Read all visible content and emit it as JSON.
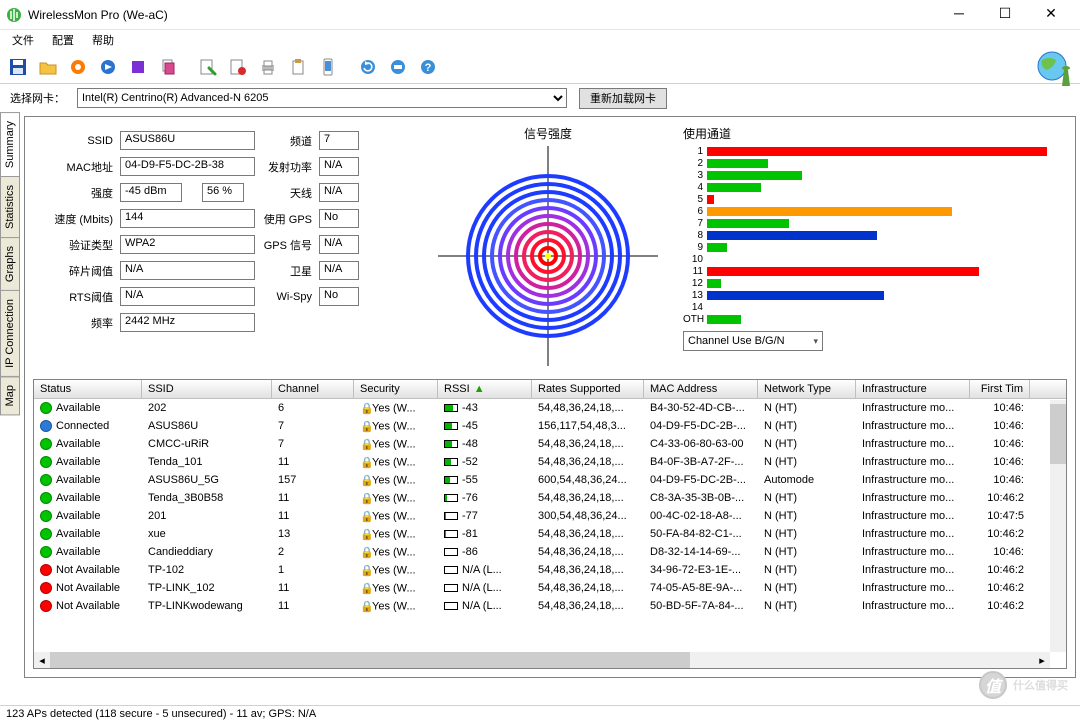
{
  "window": {
    "title": "WirelessMon Pro (We-aC)"
  },
  "menu": {
    "file": "文件",
    "config": "配置",
    "help": "帮助"
  },
  "select_nic": {
    "label": "选择网卡：",
    "value": "Intel(R) Centrino(R) Advanced-N 6205",
    "reload": "重新加载网卡"
  },
  "tabs": {
    "summary": "Summary",
    "statistics": "Statistics",
    "graphs": "Graphs",
    "ipconn": "IP Connection",
    "map": "Map"
  },
  "kv": {
    "ssid_l": "SSID",
    "ssid": "ASUS86U",
    "mac_l": "MAC地址",
    "mac": "04-D9-F5-DC-2B-38",
    "strength_l": "强度",
    "dbm": "-45 dBm",
    "pct": "56 %",
    "speed_l": "速度 (Mbits)",
    "speed": "144",
    "auth_l": "验证类型",
    "auth": "WPA2",
    "frag_l": "碎片阈值",
    "frag": "N/A",
    "rts_l": "RTS阈值",
    "rts": "N/A",
    "freq_l": "频率",
    "freq": "2442 MHz",
    "chan_l": "频道",
    "chan": "7",
    "txp_l": "发射功率",
    "txp": "N/A",
    "ant_l": "天线",
    "ant": "N/A",
    "gps_l": "使用 GPS",
    "gps": "No",
    "gpssig_l": "GPS 信号",
    "gpssig": "N/A",
    "sat_l": "卫星",
    "sat": "N/A",
    "wispy_l": "Wi-Spy",
    "wispy": "No"
  },
  "gauge": {
    "label": "信号强度"
  },
  "channels": {
    "label": "使用通道",
    "dropdown": "Channel Use B/G/N"
  },
  "chart_data": {
    "type": "bar",
    "title": "使用通道",
    "categories": [
      "1",
      "2",
      "3",
      "4",
      "5",
      "6",
      "7",
      "8",
      "9",
      "10",
      "11",
      "12",
      "13",
      "14",
      "OTH"
    ],
    "values": [
      100,
      18,
      28,
      16,
      2,
      72,
      24,
      50,
      6,
      0,
      80,
      4,
      52,
      0,
      10
    ],
    "colors": [
      "#ff0000",
      "#00c400",
      "#00c400",
      "#00c400",
      "#ff0000",
      "#ff9900",
      "#00c400",
      "#0033cc",
      "#00c400",
      "",
      "#ff0000",
      "#00c400",
      "#0033cc",
      "",
      "#00c400"
    ]
  },
  "gridh": {
    "status": "Status",
    "ssid": "SSID",
    "chan": "Channel",
    "sec": "Security",
    "rssi": "RSSI",
    "rates": "Rates Supported",
    "mac": "MAC Address",
    "ntype": "Network Type",
    "infra": "Infrastructure",
    "time": "First Tim"
  },
  "rows": [
    {
      "s": "Available",
      "c": "#00c400",
      "ssid": "202",
      "ch": "6",
      "sec": "Yes (W...",
      "r": "-43",
      "rb": 70,
      "rt": "54,48,36,24,18,...",
      "mac": "B4-30-52-4D-CB-...",
      "nt": "N (HT)",
      "in": "Infrastructure mo...",
      "t": "10:46:"
    },
    {
      "s": "Connected",
      "c": "#2b7ad9",
      "ssid": "ASUS86U",
      "ch": "7",
      "sec": "Yes (W...",
      "r": "-45",
      "rb": 62,
      "rt": "156,117,54,48,3...",
      "mac": "04-D9-F5-DC-2B-...",
      "nt": "N (HT)",
      "in": "Infrastructure mo...",
      "t": "10:46:"
    },
    {
      "s": "Available",
      "c": "#00c400",
      "ssid": "CMCC-uRiR",
      "ch": "7",
      "sec": "Yes (W...",
      "r": "-48",
      "rb": 55,
      "rt": "54,48,36,24,18,...",
      "mac": "C4-33-06-80-63-00",
      "nt": "N (HT)",
      "in": "Infrastructure mo...",
      "t": "10:46:"
    },
    {
      "s": "Available",
      "c": "#00c400",
      "ssid": "Tenda_101",
      "ch": "11",
      "sec": "Yes (W...",
      "r": "-52",
      "rb": 48,
      "rt": "54,48,36,24,18,...",
      "mac": "B4-0F-3B-A7-2F-...",
      "nt": "N (HT)",
      "in": "Infrastructure mo...",
      "t": "10:46:"
    },
    {
      "s": "Available",
      "c": "#00c400",
      "ssid": "ASUS86U_5G",
      "ch": "157",
      "sec": "Yes (W...",
      "r": "-55",
      "rb": 42,
      "rt": "600,54,48,36,24...",
      "mac": "04-D9-F5-DC-2B-...",
      "nt": "Automode",
      "in": "Infrastructure mo...",
      "t": "10:46:"
    },
    {
      "s": "Available",
      "c": "#00c400",
      "ssid": "Tenda_3B0B58",
      "ch": "11",
      "sec": "Yes (W...",
      "r": "-76",
      "rb": 14,
      "rt": "54,48,36,24,18,...",
      "mac": "C8-3A-35-3B-0B-...",
      "nt": "N (HT)",
      "in": "Infrastructure mo...",
      "t": "10:46:2"
    },
    {
      "s": "Available",
      "c": "#00c400",
      "ssid": "201",
      "ch": "11",
      "sec": "Yes (W...",
      "r": "-77",
      "rb": 12,
      "rt": "300,54,48,36,24...",
      "mac": "00-4C-02-18-A8-...",
      "nt": "N (HT)",
      "in": "Infrastructure mo...",
      "t": "10:47:5"
    },
    {
      "s": "Available",
      "c": "#00c400",
      "ssid": "xue",
      "ch": "13",
      "sec": "Yes (W...",
      "r": "-81",
      "rb": 8,
      "rt": "54,48,36,24,18,...",
      "mac": "50-FA-84-82-C1-...",
      "nt": "N (HT)",
      "in": "Infrastructure mo...",
      "t": "10:46:2"
    },
    {
      "s": "Available",
      "c": "#00c400",
      "ssid": "Candieddiary",
      "ch": "2",
      "sec": "Yes (W...",
      "r": "-86",
      "rb": 0,
      "rt": "54,48,36,24,18,...",
      "mac": "D8-32-14-14-69-...",
      "nt": "N (HT)",
      "in": "Infrastructure mo...",
      "t": "10:46:"
    },
    {
      "s": "Not Available",
      "c": "#ff0000",
      "ssid": "TP-102",
      "ch": "1",
      "sec": "Yes (W...",
      "r": "N/A (L...",
      "rb": 0,
      "rt": "54,48,36,24,18,...",
      "mac": "34-96-72-E3-1E-...",
      "nt": "N (HT)",
      "in": "Infrastructure mo...",
      "t": "10:46:2"
    },
    {
      "s": "Not Available",
      "c": "#ff0000",
      "ssid": "TP-LINK_102",
      "ch": "11",
      "sec": "Yes (W...",
      "r": "N/A (L...",
      "rb": 0,
      "rt": "54,48,36,24,18,...",
      "mac": "74-05-A5-8E-9A-...",
      "nt": "N (HT)",
      "in": "Infrastructure mo...",
      "t": "10:46:2"
    },
    {
      "s": "Not Available",
      "c": "#ff0000",
      "ssid": "TP-LINKwodewang",
      "ch": "11",
      "sec": "Yes (W...",
      "r": "N/A (L...",
      "rb": 0,
      "rt": "54,48,36,24,18,...",
      "mac": "50-BD-5F-7A-84-...",
      "nt": "N (HT)",
      "in": "Infrastructure mo...",
      "t": "10:46:2"
    }
  ],
  "status": "123 APs detected (118 secure - 5 unsecured) - 11 av; GPS: N/A",
  "wm": "什么值得买"
}
